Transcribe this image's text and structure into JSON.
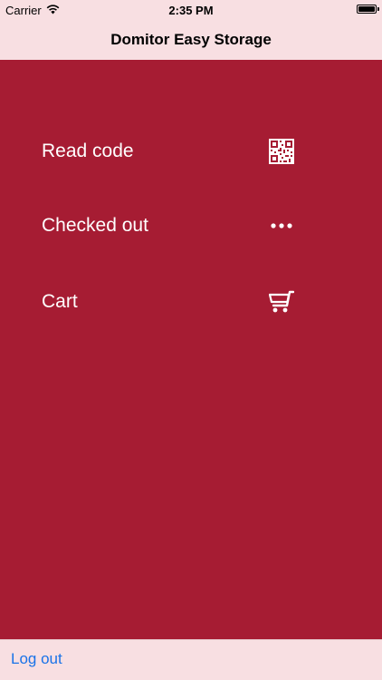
{
  "status_bar": {
    "carrier": "Carrier",
    "time": "2:35 PM"
  },
  "nav": {
    "title": "Domitor Easy Storage"
  },
  "menu": {
    "items": [
      {
        "label": "Read code",
        "icon": "qr-code-icon"
      },
      {
        "label": "Checked out",
        "icon": "more-dots-icon"
      },
      {
        "label": "Cart",
        "icon": "cart-icon"
      }
    ]
  },
  "toolbar": {
    "logout_label": "Log out"
  },
  "colors": {
    "accent": "#a61c33",
    "bar_background": "#f8dfe2",
    "link": "#1a73e8"
  }
}
